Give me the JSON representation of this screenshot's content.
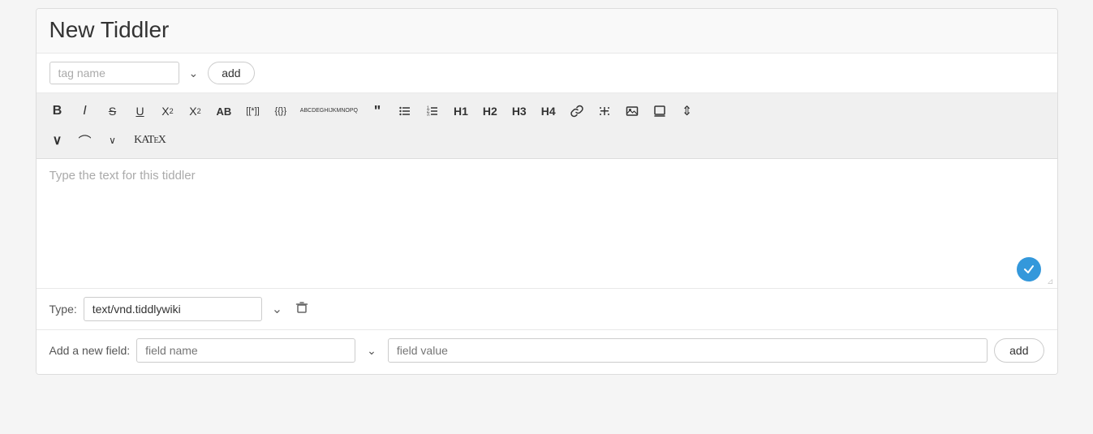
{
  "title": "New Tiddler",
  "tags": {
    "input_placeholder": "tag name",
    "add_label": "add"
  },
  "toolbar": {
    "row1": [
      {
        "name": "bold",
        "label": "B",
        "class": "bold"
      },
      {
        "name": "italic",
        "label": "I",
        "class": "italic"
      },
      {
        "name": "strikethrough",
        "label": "S",
        "class": "strike"
      },
      {
        "name": "underline",
        "label": "U",
        "class": "underline"
      },
      {
        "name": "superscript",
        "label": "X²"
      },
      {
        "name": "subscript",
        "label": "X₂"
      },
      {
        "name": "uppercase",
        "label": "AB"
      },
      {
        "name": "bracket-link",
        "label": "[[*]]"
      },
      {
        "name": "macro",
        "label": "{{}}"
      },
      {
        "name": "abcde",
        "label": "ABCDE\nGHIJK\nMNOPQ"
      },
      {
        "name": "quote",
        "label": "❝"
      },
      {
        "name": "bullet-list",
        "label": "≡"
      },
      {
        "name": "numbered-list",
        "label": "≡"
      },
      {
        "name": "h1",
        "label": "H1"
      },
      {
        "name": "h2",
        "label": "H2"
      },
      {
        "name": "h3",
        "label": "H3"
      },
      {
        "name": "h4",
        "label": "H4"
      },
      {
        "name": "link",
        "label": "🔗"
      },
      {
        "name": "widget",
        "label": "⚡"
      },
      {
        "name": "image",
        "label": "🖼"
      },
      {
        "name": "stamp",
        "label": "🖹"
      },
      {
        "name": "more",
        "label": "⇕"
      }
    ],
    "row2": [
      {
        "name": "chevron-down",
        "label": "∨"
      },
      {
        "name": "tilde",
        "label": "~"
      },
      {
        "name": "chevron-small",
        "label": "∨"
      },
      {
        "name": "katex",
        "label": "KaTeX"
      }
    ]
  },
  "editor": {
    "placeholder": "Type the text for this tiddler"
  },
  "type_section": {
    "label": "Type:",
    "value": "text/vnd.tiddlywiki"
  },
  "fields_section": {
    "label": "Add a new field:",
    "field_name_placeholder": "field name",
    "field_value_placeholder": "field value",
    "add_label": "add"
  },
  "colors": {
    "confirm_blue": "#3498db",
    "toolbar_bg": "#f0f0f0",
    "border": "#ddd"
  }
}
